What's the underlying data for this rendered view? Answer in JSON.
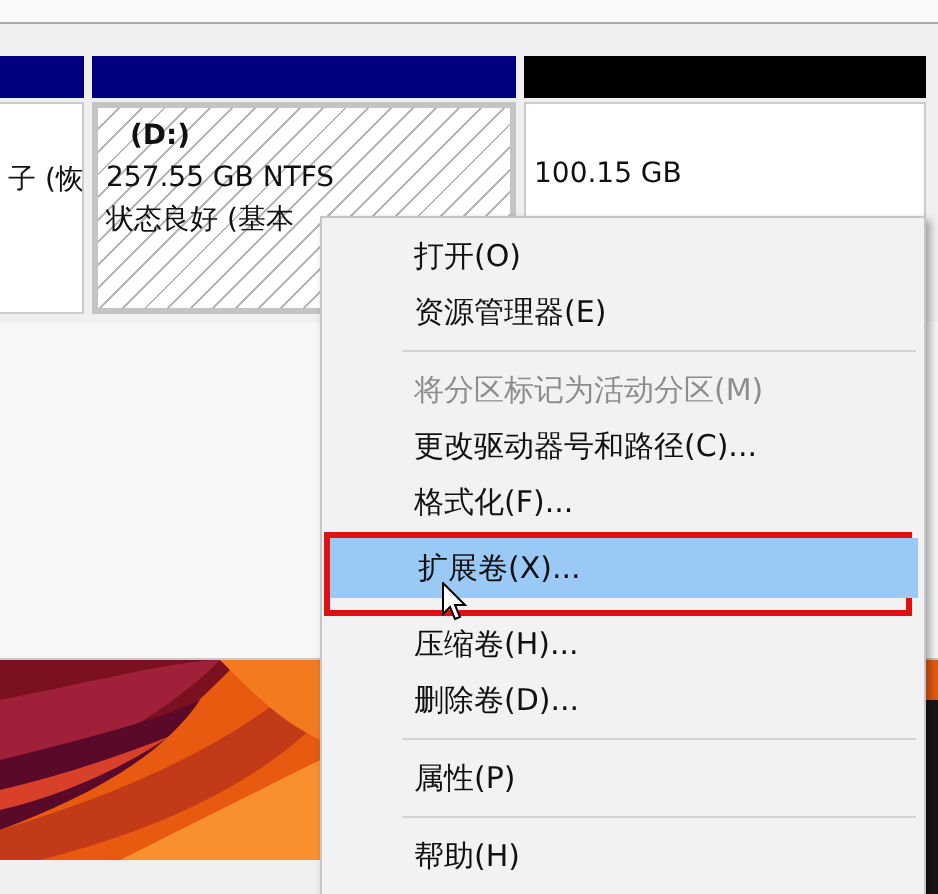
{
  "partitions": [
    {
      "kind": "plain",
      "color": "#000080",
      "lines": [
        "子 (恢"
      ]
    },
    {
      "kind": "hatched",
      "color": "#000080",
      "name": "(D:)",
      "lines": [
        "257.55 GB NTFS",
        "状态良好 (基本"
      ]
    },
    {
      "kind": "plain",
      "color": "#000000",
      "lines": [
        "100.15 GB"
      ]
    }
  ],
  "context_menu": {
    "items": [
      {
        "kind": "item",
        "label": "打开(O)",
        "disabled": false,
        "selected": false,
        "outlined": false
      },
      {
        "kind": "item",
        "label": "资源管理器(E)",
        "disabled": false,
        "selected": false,
        "outlined": false
      },
      {
        "kind": "separator"
      },
      {
        "kind": "item",
        "label": "将分区标记为活动分区(M)",
        "disabled": true,
        "selected": false,
        "outlined": false
      },
      {
        "kind": "item",
        "label": "更改驱动器号和路径(C)...",
        "disabled": false,
        "selected": false,
        "outlined": false
      },
      {
        "kind": "item",
        "label": "格式化(F)...",
        "disabled": false,
        "selected": false,
        "outlined": false
      },
      {
        "kind": "item",
        "label": "扩展卷(X)...",
        "disabled": false,
        "selected": true,
        "outlined": true
      },
      {
        "kind": "item",
        "label": "压缩卷(H)...",
        "disabled": false,
        "selected": false,
        "outlined": false
      },
      {
        "kind": "item",
        "label": "删除卷(D)...",
        "disabled": false,
        "selected": false,
        "outlined": false
      },
      {
        "kind": "separator"
      },
      {
        "kind": "item",
        "label": "属性(P)",
        "disabled": false,
        "selected": false,
        "outlined": false
      },
      {
        "kind": "separator"
      },
      {
        "kind": "item",
        "label": "帮助(H)",
        "disabled": false,
        "selected": false,
        "outlined": false
      }
    ]
  }
}
